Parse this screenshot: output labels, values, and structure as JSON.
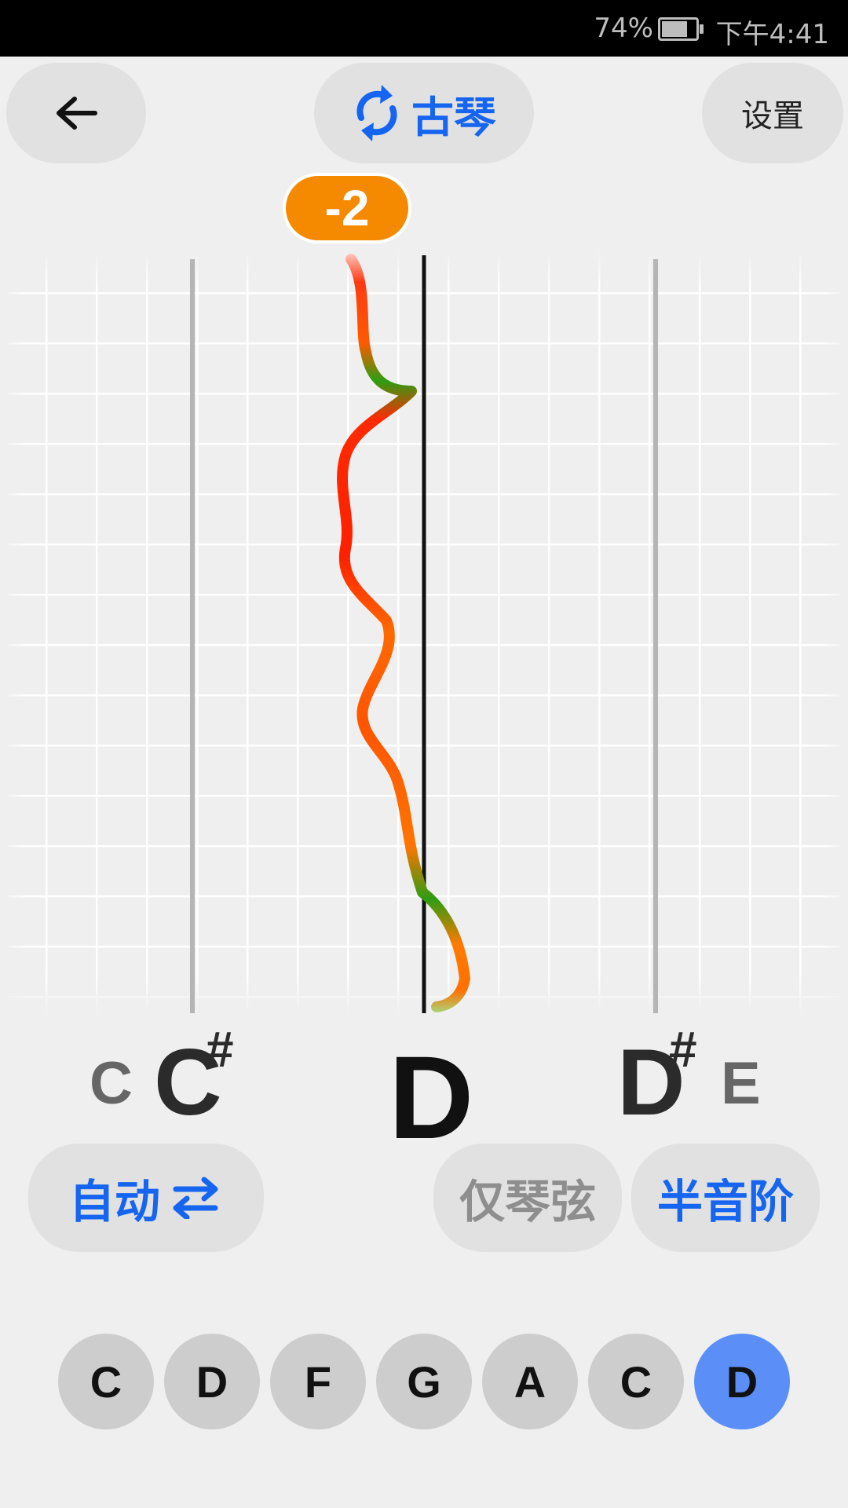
{
  "status_bar": {
    "battery": "74%",
    "time": "下午4:41"
  },
  "header": {
    "back_icon": "arrow-left-icon",
    "instrument_icon": "refresh-icon",
    "instrument_label": "古琴",
    "settings_label": "设置"
  },
  "tuner": {
    "cents_offset": "-2",
    "target_note": "D",
    "notes": {
      "far_left": "C",
      "left": "C",
      "left_sharp": "#",
      "center": "D",
      "right": "D",
      "right_sharp": "#",
      "far_right": "E"
    },
    "colors": {
      "in_tune": "#2e9d12",
      "sharp_flat": "#ff2a00",
      "badge": "#f58a00",
      "accent": "#1565f0"
    }
  },
  "controls": {
    "auto_label": "自动",
    "auto_icon": "swap-arrows-icon",
    "strings_only_label": "仅琴弦",
    "chromatic_label": "半音阶"
  },
  "strings": [
    {
      "label": "C",
      "active": false
    },
    {
      "label": "D",
      "active": false
    },
    {
      "label": "F",
      "active": false
    },
    {
      "label": "G",
      "active": false
    },
    {
      "label": "A",
      "active": false
    },
    {
      "label": "C",
      "active": false
    },
    {
      "label": "D",
      "active": true
    }
  ]
}
